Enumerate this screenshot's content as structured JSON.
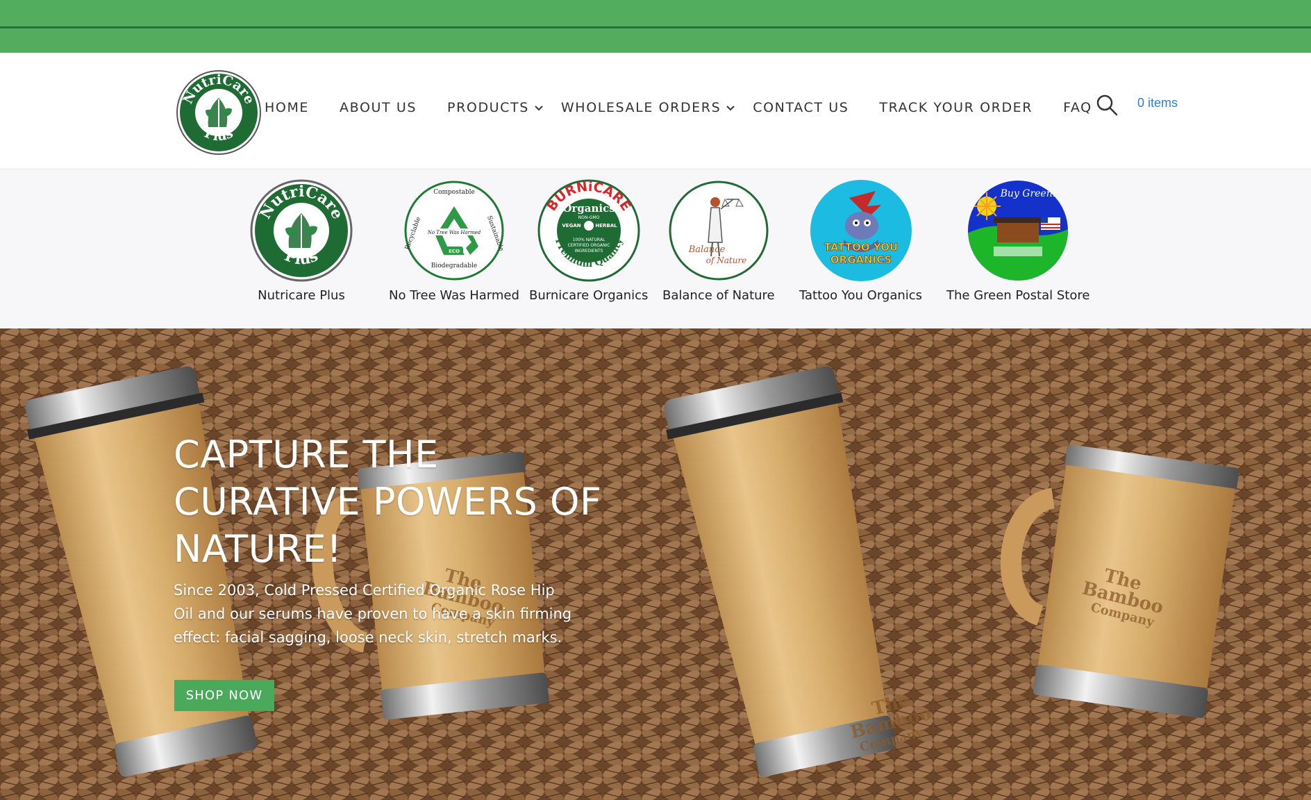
{
  "colors": {
    "top_bar": "#52ad5f",
    "accent_green": "#4aa95a",
    "link_blue": "#2c7fd6",
    "logo_green": "#1f6b34"
  },
  "logo": {
    "top_text": "NutriCare",
    "bottom_text": "Plus"
  },
  "nav": {
    "items": [
      {
        "label": "HOME"
      },
      {
        "label": "ABOUT US"
      },
      {
        "label": "PRODUCTS",
        "dropdown": true
      },
      {
        "label": "WHOLESALE ORDERS",
        "dropdown": true
      },
      {
        "label": "CONTACT US"
      },
      {
        "label": "TRACK YOUR ORDER"
      },
      {
        "label": "FAQ"
      }
    ],
    "search_icon": "search-icon",
    "cart_label": "0 items"
  },
  "brands": [
    {
      "label": "Nutricare Plus",
      "logo_top": "NutriCare",
      "logo_bottom": "Plus"
    },
    {
      "label": "No Tree Was Harmed",
      "logo_lines": [
        "Compostable",
        "Recyclable",
        "Sustainable",
        "No Tree Was Harmed",
        "ECO",
        "Biodegradable"
      ]
    },
    {
      "label": "Burnicare Organics",
      "logo_lines": [
        "BURNiCARE",
        "Organics",
        "NON-GMO",
        "VEGAN",
        "HERBAL",
        "100% NATURAL",
        "CERTIFIED ORGANIC",
        "INGREDIENTS",
        "Premium Quality"
      ]
    },
    {
      "label": "Balance of Nature",
      "logo_lines": [
        "Balance",
        "of Nature"
      ]
    },
    {
      "label": "Tattoo You Organics",
      "logo_lines": [
        "TATTOO YOU",
        "ORGANICS"
      ]
    },
    {
      "label": "The Green Postal Store",
      "logo_lines": [
        "Buy Green!"
      ]
    }
  ],
  "hero": {
    "heading": "CAPTURE THE CURATIVE POWERS OF NATURE!",
    "text": "Since 2003, Cold Pressed Certified Organic Rose Hip Oil and our serums have proven to have a skin firming effect: facial sagging, loose neck skin, stretch marks.",
    "button": "SHOP NOW",
    "mug_engraving": [
      "The",
      "Bamboo",
      "Company"
    ]
  }
}
